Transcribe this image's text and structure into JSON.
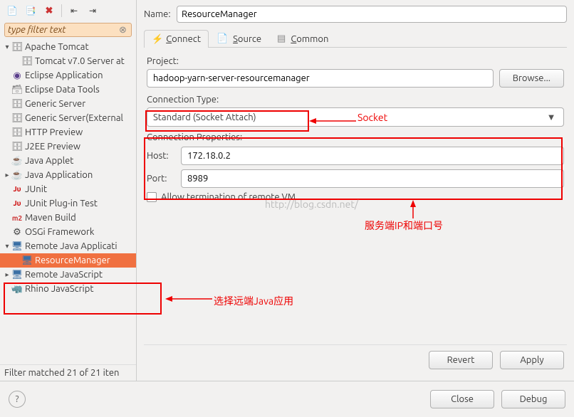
{
  "toolbar": {
    "filter_placeholder": "type filter text"
  },
  "tree": {
    "items": [
      {
        "label": "Apache Tomcat",
        "expanded": true,
        "icon": "server"
      },
      {
        "label": "Tomcat v7.0 Server at",
        "child": true,
        "icon": "server"
      },
      {
        "label": "Eclipse Application",
        "icon": "eclipse"
      },
      {
        "label": "Eclipse Data Tools",
        "icon": "db"
      },
      {
        "label": "Generic Server",
        "icon": "server"
      },
      {
        "label": "Generic Server(External",
        "icon": "server"
      },
      {
        "label": "HTTP Preview",
        "icon": "server"
      },
      {
        "label": "J2EE Preview",
        "icon": "server"
      },
      {
        "label": "Java Applet",
        "icon": "java"
      },
      {
        "label": "Java Application",
        "expandable": true,
        "icon": "java"
      },
      {
        "label": "JUnit",
        "icon": "ju"
      },
      {
        "label": "JUnit Plug-in Test",
        "icon": "ju"
      },
      {
        "label": "Maven Build",
        "icon": "m2"
      },
      {
        "label": "OSGi Framework",
        "icon": "osgi"
      },
      {
        "label": "Remote Java Applicati",
        "expanded": true,
        "icon": "remote"
      },
      {
        "label": "ResourceManager",
        "child": true,
        "selected": true,
        "icon": "remote"
      },
      {
        "label": "Remote JavaScript",
        "expandable": true,
        "icon": "remote"
      },
      {
        "label": "Rhino JavaScript",
        "icon": "rhino"
      }
    ],
    "filter_count": "Filter matched 21 of 21 iten"
  },
  "form": {
    "name_label": "Name:",
    "name_value": "ResourceManager",
    "tabs": {
      "connect": "Connect",
      "source": "Source",
      "common": "Common"
    },
    "project_label": "Project:",
    "project_value": "hadoop-yarn-server-resourcemanager",
    "browse": "Browse...",
    "conn_type_label": "Connection Type:",
    "conn_type_value": "Standard (Socket Attach)",
    "conn_props_label": "Connection Properties:",
    "host_label": "Host:",
    "host_value": "172.18.0.2",
    "port_label": "Port:",
    "port_value": "8989",
    "allow_term": "Allow termination of remote VM",
    "revert": "Revert",
    "apply": "Apply"
  },
  "footer": {
    "close": "Close",
    "debug": "Debug"
  },
  "annotations": {
    "socket": "Socket",
    "select_remote": "选择远端Java应用",
    "server_ip_port": "服务端IP和端口号"
  },
  "watermark": "http://blog.csdn.net/"
}
